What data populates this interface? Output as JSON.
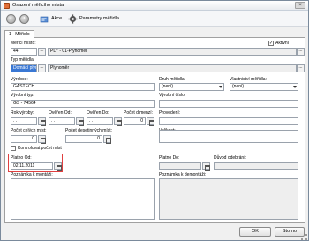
{
  "window": {
    "title": "Osazení měřicího místa",
    "close_glyph": "×"
  },
  "toolbar": {
    "back_glyph": "‹",
    "forward_glyph": "›",
    "actions_label": "Akce",
    "params_label": "Parametry měřidla"
  },
  "tabs": [
    {
      "label": "1 - Měřidlo"
    }
  ],
  "form": {
    "merici_misto": {
      "label": "Měřicí místo:",
      "value": "44",
      "ellipsis": "...",
      "description": "PLY - 01-Plynoměr"
    },
    "aktivni": {
      "label": "Aktivní",
      "checked": true,
      "check_glyph": "✓"
    },
    "typ_meridla": {
      "label": "Typ měřidla:",
      "value": "Domácí plyn",
      "ellipsis": "...",
      "description": "Plynoměr"
    },
    "vyrobce": {
      "label": "Výrobce:",
      "value": "GASTECH"
    },
    "druh_meridla": {
      "label": "Druh měřidla:",
      "value": "(není)"
    },
    "vlastnictvi_meridla": {
      "label": "Vlastnictví měřidla:",
      "value": "(není)"
    },
    "vyrobni_typ": {
      "label": "Výrobní typ:",
      "value": "GS - 74564"
    },
    "vyrobni_cislo": {
      "label": "Výrobní číslo:",
      "value": ""
    },
    "rok_vyroby": {
      "label": "Rok výroby:",
      "value": ". ."
    },
    "overeno_od": {
      "label": "Ověřen Od:",
      "value": ". ."
    },
    "overeno_do": {
      "label": "Ověřen Do:",
      "value": ". ."
    },
    "pocet_dimenzi": {
      "label": "Počet dimenzí:",
      "value": "0"
    },
    "provedeni": {
      "label": "Provedení:",
      "value": ""
    },
    "pocet_celych_mist": {
      "label": "Počet celých míst:",
      "value": "0"
    },
    "pocet_desetinnych_mist": {
      "label": "Počet desetinných míst:",
      "value": "0"
    },
    "velikost": {
      "label": "Velikost:",
      "value": ""
    },
    "kontrolovat_pocet_mist": {
      "label": "Kontrolovat počet míst",
      "checked": false
    },
    "platno_od": {
      "label": "Platno Od:",
      "value": "02.11.2011"
    },
    "platno_do": {
      "label": "Platno Do:",
      "value": ""
    },
    "duvod_odebrani": {
      "label": "Důvod odebrání:",
      "value": ""
    },
    "poznamka_k_montazi": {
      "label": "Poznámka k montáži:"
    },
    "poznamka_k_demontazi": {
      "label": "Poznámka k demontáži:"
    }
  },
  "buttons": {
    "ok": "OK",
    "storno": "Storno"
  }
}
